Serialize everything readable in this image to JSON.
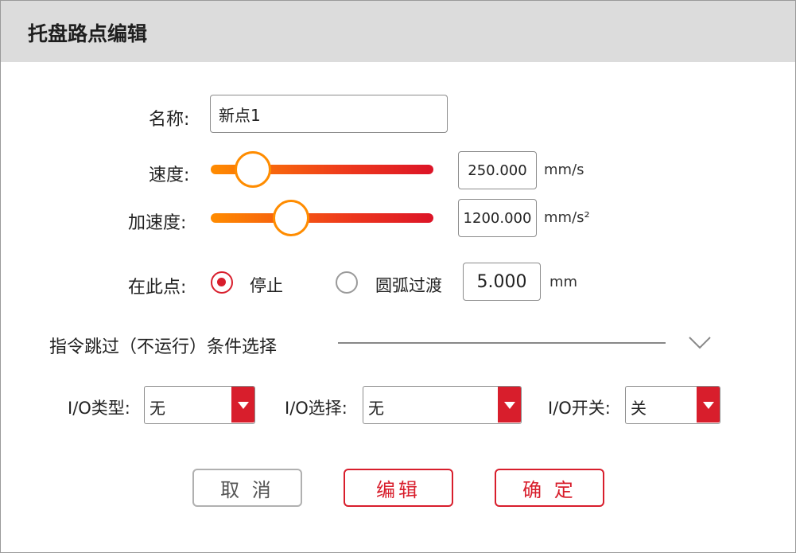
{
  "dialog": {
    "title": "托盘路点编辑"
  },
  "form": {
    "name_label": "名称:",
    "name_value": "新点1",
    "speed_label": "速度:",
    "speed_value": "250.000",
    "speed_unit": "mm/s",
    "speed_level": 0.19,
    "accel_label": "加速度:",
    "accel_value": "1200.000",
    "accel_unit": "mm/s²",
    "accel_level": 0.36,
    "at_point_label": "在此点:",
    "stop_label": "停止",
    "stop_selected": true,
    "arc_label": "圆弧过渡",
    "arc_selected": false,
    "arc_value": "5.000",
    "arc_unit": "mm"
  },
  "skip_section": {
    "title": "指令跳过（不运行）条件选择",
    "icon": "chevron-down-icon"
  },
  "io": {
    "type_label": "I/O类型:",
    "type_value": "无",
    "select_label": "I/O选择:",
    "select_value": "无",
    "switch_label": "I/O开关:",
    "switch_value": "关"
  },
  "buttons": {
    "cancel": "取 消",
    "edit": "编辑",
    "ok": "确 定"
  },
  "colors": {
    "accent": "#d81e2c",
    "slider_start": "#ff8c00",
    "titlebar": "#dcdcdc"
  }
}
